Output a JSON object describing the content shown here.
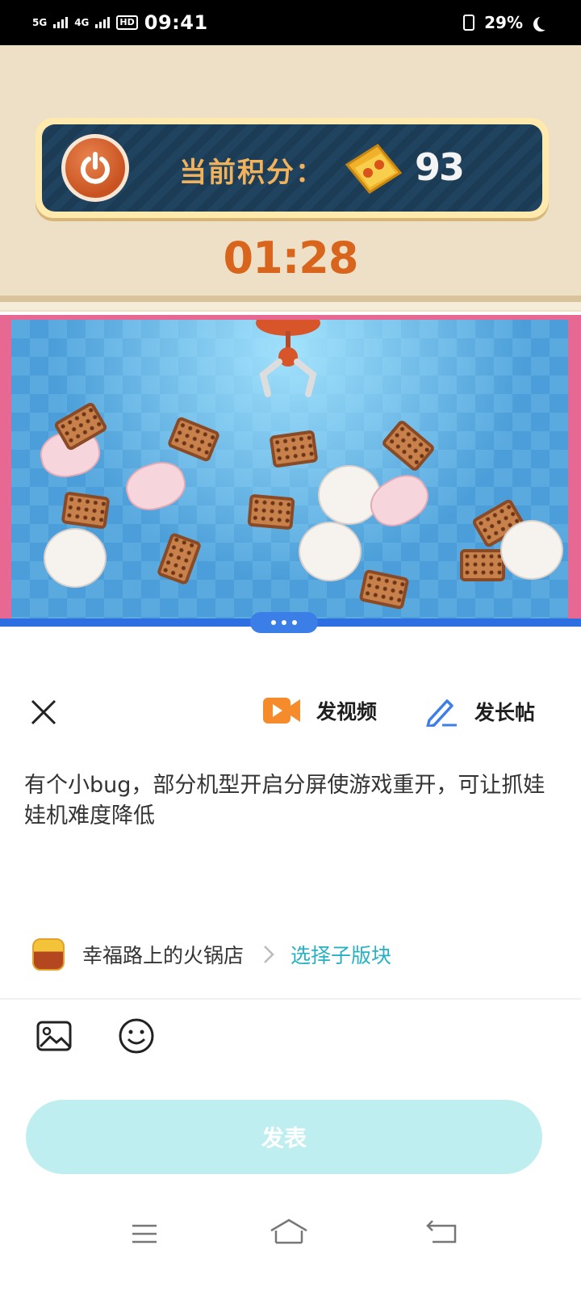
{
  "status_bar": {
    "network_1": "5G",
    "network_2": "4G",
    "hd": "HD",
    "time": "09:41",
    "battery": "29%"
  },
  "game": {
    "score_label": "当前积分：",
    "score_value": "93",
    "timer": "01:28"
  },
  "composer": {
    "video_label": "发视频",
    "long_post_label": "发长帖",
    "post_text": "有个小bug，部分机型开启分屏使游戏重开，可让抓娃娃机难度降低",
    "forum_name": "幸福路上的火锅店",
    "sub_forum_label": "选择子版块",
    "publish_label": "发表",
    "colors": {
      "accent": "#27b2c4",
      "publish_bg": "#bfeef0",
      "video_icon": "#f58b2a",
      "pen_icon": "#3d7fe6"
    }
  },
  "icons": [
    "close-icon",
    "video-icon",
    "pen-icon",
    "image-icon",
    "emoji-icon",
    "chevron-right-icon",
    "menu-icon",
    "home-icon",
    "back-icon",
    "power-icon",
    "ticket-icon"
  ]
}
